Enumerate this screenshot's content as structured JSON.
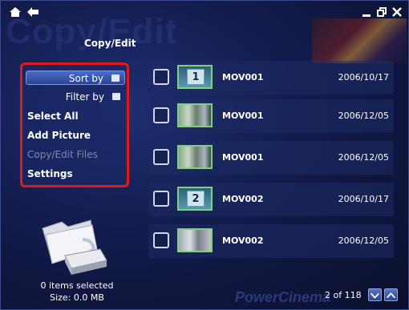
{
  "window": {
    "watermark_title": "Copy/Edit",
    "title": "Copy/Edit"
  },
  "menu": {
    "sort_by": "Sort by",
    "filter_by": "Filter by",
    "select_all": "Select All",
    "add_picture": "Add Picture",
    "copy_edit_files": "Copy/Edit Files",
    "settings": "Settings"
  },
  "files": [
    {
      "thumb_label": "1",
      "name": "MOV001",
      "date": "2006/10/17"
    },
    {
      "thumb_label": "",
      "name": "MOV001",
      "date": "2006/12/05"
    },
    {
      "thumb_label": "",
      "name": "MOV001",
      "date": "2006/12/05"
    },
    {
      "thumb_label": "2",
      "name": "MOV002",
      "date": "2006/10/17"
    },
    {
      "thumb_label": "",
      "name": "MOV002",
      "date": "2006/12/05"
    }
  ],
  "footer": {
    "selected_count": "0 items selected",
    "selected_size": "Size: 0.0 MB",
    "brand_watermark": "PowerCinema",
    "page_indicator": "2 of 118"
  },
  "colors": {
    "highlight_border": "#e01a1a",
    "thumb_border": "#7fd07f"
  }
}
